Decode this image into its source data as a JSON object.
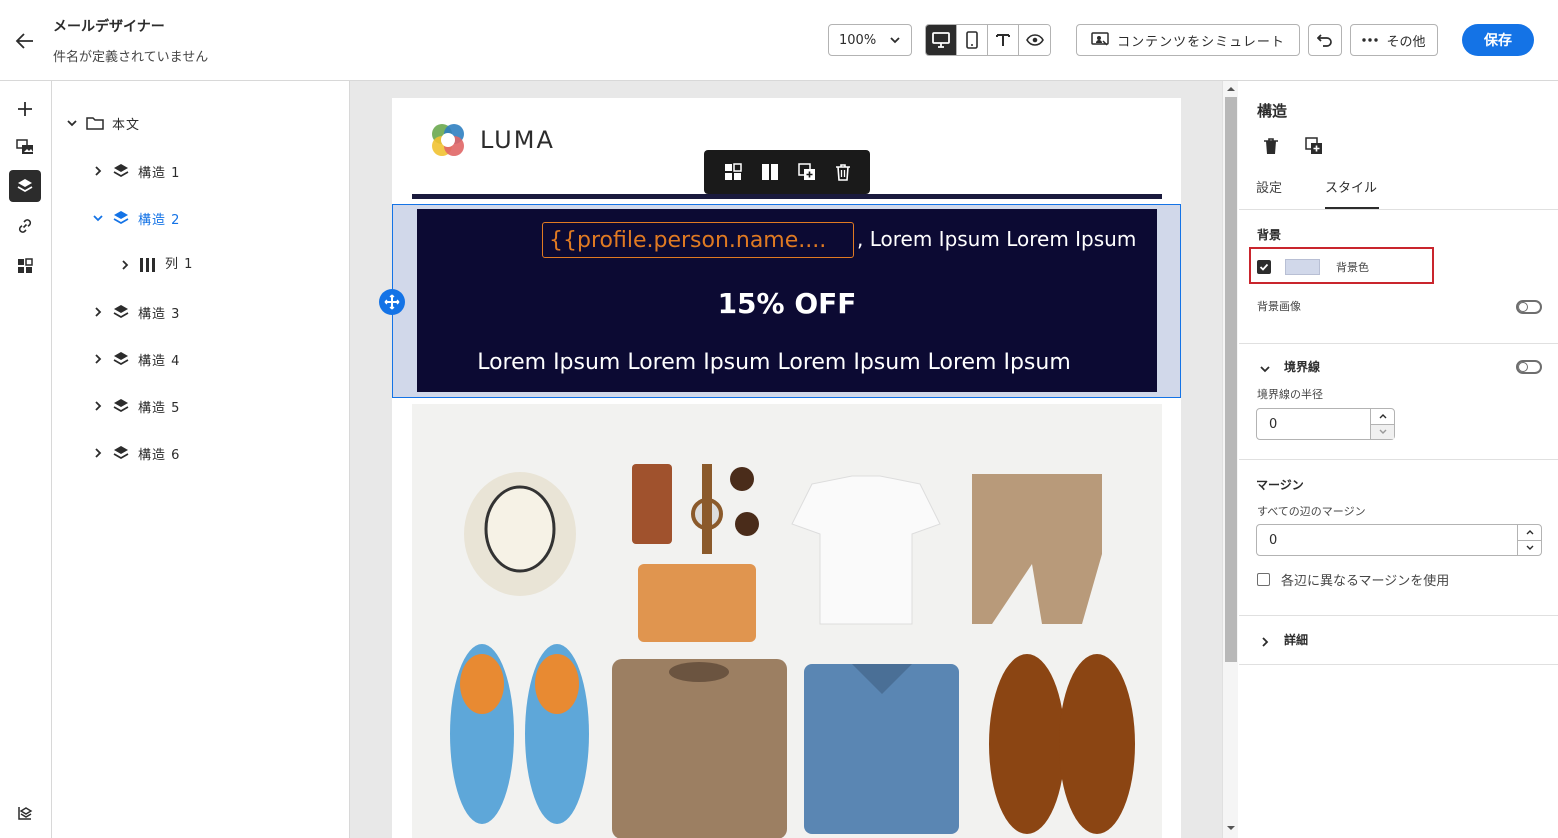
{
  "header": {
    "title": "メールデザイナー",
    "subtitle": "件名が定義されていません",
    "zoom": "100%",
    "simulate_label": "コンテンツをシミュレート",
    "more_label": "その他",
    "save_label": "保存"
  },
  "tree": {
    "root_label": "本文",
    "items": [
      {
        "label": "構造 1"
      },
      {
        "label": "構造 2"
      },
      {
        "label": "列 1"
      },
      {
        "label": "構造 3"
      },
      {
        "label": "構造 4"
      },
      {
        "label": "構造 5"
      },
      {
        "label": "構造 6"
      }
    ]
  },
  "email": {
    "logo_text": "LUMA",
    "personalization_token": "{{profile.person.name....",
    "greeting_suffix": ", Lorem Ipsum Lorem Ipsum",
    "offer": "15% OFF",
    "body_text": "Lorem Ipsum Lorem Ipsum Lorem Ipsum Lorem Ipsum"
  },
  "panel": {
    "title": "構造",
    "tabs": [
      {
        "label": "設定"
      },
      {
        "label": "スタイル"
      }
    ],
    "active_tab": "スタイル",
    "background": {
      "heading": "背景",
      "color_label": "背景色",
      "color_checked": true,
      "swatch_color": "#d1d8ea",
      "image_label": "背景画像",
      "image_enabled": false
    },
    "border": {
      "heading": "境界線",
      "enabled": false,
      "radius_label": "境界線の半径",
      "radius_value": "0"
    },
    "margin": {
      "heading": "マージン",
      "all_label": "すべての辺のマージン",
      "all_value": "0",
      "different_label": "各辺に異なるマージンを使用",
      "different_checked": false
    },
    "details_label": "詳細"
  },
  "colors": {
    "accent": "#1473e6",
    "hero_bg": "#0c0a33",
    "hero_frame": "#d1d8ea",
    "token_orange": "#e07a22",
    "highlight_red": "#c9252d"
  }
}
